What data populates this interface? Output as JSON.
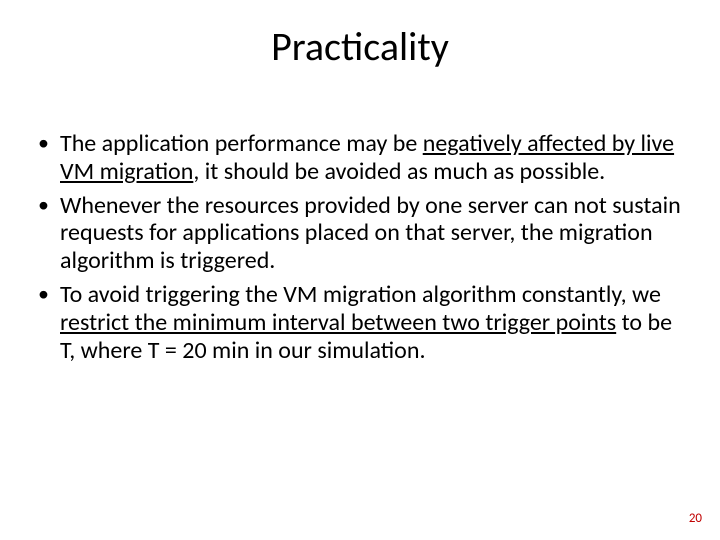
{
  "title": "Practicality",
  "bullets": {
    "b1": {
      "pre": "The application performance may be ",
      "u": "negatively affected by live VM migration",
      "post": ", it should be avoided as much as possible."
    },
    "b2": {
      "text": "Whenever the resources provided by one server can not sustain requests for applications placed on that server, the migration algorithm is triggered."
    },
    "b3": {
      "pre": "To avoid triggering the VM migration algorithm constantly, we ",
      "u": "restrict the minimum interval between two trigger points",
      "post": " to be T, where T = 20 min in our simulation."
    }
  },
  "page_number": "20"
}
